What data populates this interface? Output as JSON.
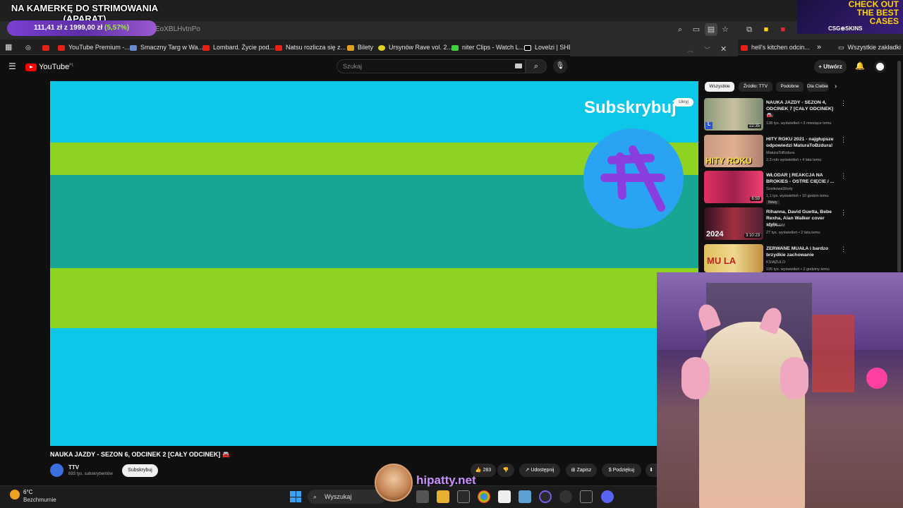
{
  "overlay": {
    "title_line1": "NA KAMERKĘ DO STRIMOWANIA",
    "title_line2": "(APARAT)",
    "price_current": "111,41 zł",
    "price_sep": "z",
    "price_goal": "1999,00 zł",
    "price_pct": "(5,57%)"
  },
  "browser": {
    "url_fragment": "EoXBLHvtnPo",
    "bookmarks": [
      "YouTube Premium -...",
      "Smaczny Targ w Wa...",
      "Lombard. Życie pod...",
      "Natsu rozlicza się z...",
      "Bilety",
      "Ursynów Rave vol. 2...",
      "niter Clips - Watch L...",
      "Lovelzi | SHEIN",
      "hell's kitchen odcin...",
      "Wszystkie zakładki"
    ]
  },
  "ad": {
    "line1": "CHECK OUT",
    "line2": "THE BEST",
    "line3": "CASES",
    "brand": "CSG⊕SKINS"
  },
  "youtube": {
    "logo": "YouTube",
    "logo_region": "PL",
    "search_placeholder": "Szukaj",
    "create_label": "Utwórz",
    "video": {
      "subscribe_overlay": "Subskrybuj",
      "hide_label": "Ukryj"
    },
    "title": "NAUKA JAZDY - SEZON 6, ODCINEK 2 [CAŁY ODCINEK] 🚘",
    "channel": {
      "name": "TTV",
      "subs": "693 tys. subskrybentów",
      "subscribe": "Subskrybuj"
    },
    "actions": {
      "likes": "283",
      "share": "Udostępnij",
      "save": "Zapisz",
      "thanks": "Podziękuj"
    },
    "chips": [
      "Wszystkie",
      "Źródło: TTV",
      "Podobne",
      "Dla Ciebie"
    ],
    "recommendations": [
      {
        "title": "NAUKA JAZDY - SEZON 4, ODCINEK 7 [CAŁY ODCINEK] 🚘",
        "channel": "TTV",
        "meta": "138 tys. wyświetleń • 3 miesiące temu",
        "duration": "22:35"
      },
      {
        "title": "HITY ROKU 2021 - najgłupsze odpowiedzi MaturaToBzdura!",
        "channel": "MaturaToBzdura",
        "meta": "2,3 mln wyświetleń • 4 lata temu",
        "duration": "",
        "thumb_text": "HITY ROKU 2021"
      },
      {
        "title": "WŁODAR | REAKCJA NA BROKIES - OSTRE CIĘCIE / ...",
        "channel": "SosikowaShoty",
        "meta": "1,1 tys. wyświetleń • 10 godzin temu",
        "badge": "Nowy",
        "duration": "6:59"
      },
      {
        "title": "Rihanna, David Guetta, Bebe Rexha, Alan Walker cover style...",
        "channel": "Tasty EDM",
        "meta": "27 tys. wyświetleń • 2 lata temu",
        "duration": "3:10:23",
        "thumb_text": "2024"
      },
      {
        "title": "ZERWANE MUAŁA i bardzo brzydkie zachowanie",
        "channel": "KSIĄŻULO",
        "meta": "195 tys. wyświetleń • 2 godziny temu",
        "duration": "",
        "thumb_text": "MU LA"
      }
    ]
  },
  "taskbar": {
    "temp": "6°C",
    "weather": "Bezchmurnie",
    "search": "Wyszukaj"
  },
  "streamer_watermark": "hipatty.net"
}
